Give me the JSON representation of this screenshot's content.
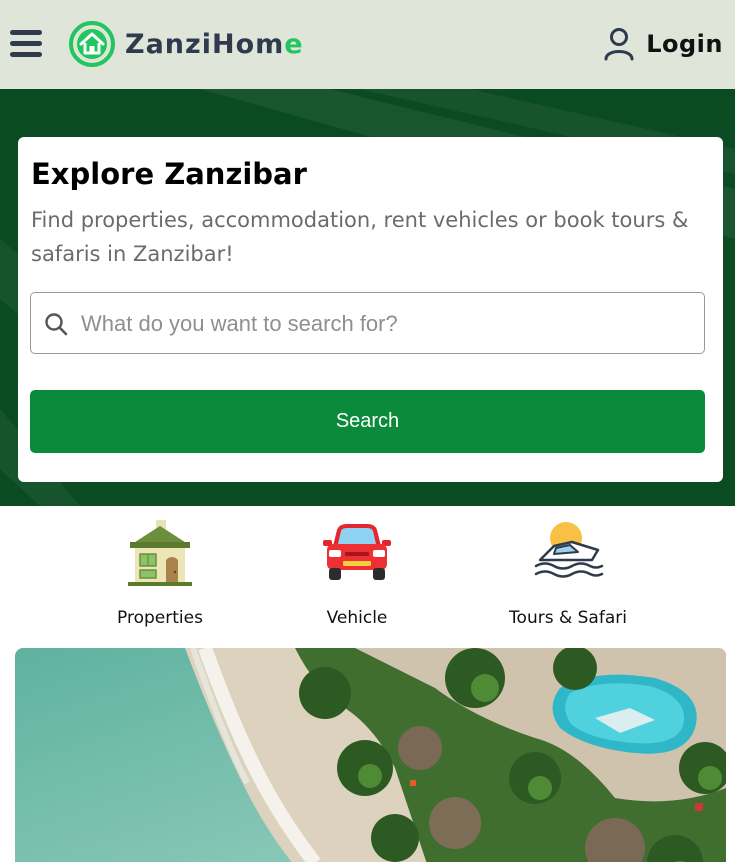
{
  "header": {
    "brand_main": "ZanziHom",
    "brand_accent": "e",
    "login_label": "Login",
    "menu_icon": "hamburger-menu-icon",
    "login_icon": "user-icon"
  },
  "hero": {
    "title": "Explore Zanzibar",
    "subtitle": "Find properties, accommodation, rent vehicles or book tours & safaris in Zanzibar!",
    "search": {
      "placeholder": "What do you want to search for?",
      "value": "",
      "button_label": "Search"
    }
  },
  "categories": [
    {
      "label": "Properties",
      "icon": "house-icon"
    },
    {
      "label": "Vehicle",
      "icon": "car-icon"
    },
    {
      "label": "Tours & Safari",
      "icon": "boat-icon"
    }
  ],
  "colors": {
    "header_bg": "#dfe5d8",
    "hero_bg": "#0b4b22",
    "primary_button": "#0c8a3c",
    "brand_accent": "#22c55e"
  }
}
